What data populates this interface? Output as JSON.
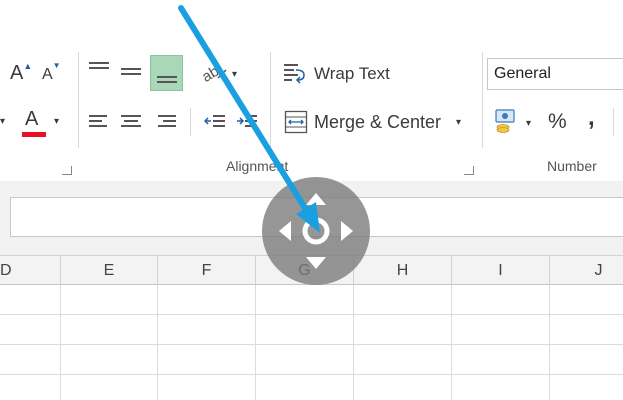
{
  "ribbon": {
    "font_group": {
      "grow_font_label": "A",
      "shrink_font_label": "A",
      "font_color_label": "A",
      "font_color_bar": "#e81123"
    },
    "alignment_group": {
      "label": "Alignment",
      "wrap_text_label": "Wrap Text",
      "merge_center_label": "Merge & Center"
    },
    "number_group": {
      "label": "Number",
      "format_value": "General",
      "percent_label": "%",
      "comma_label": ","
    }
  },
  "grid": {
    "columns": [
      "D",
      "E",
      "F",
      "G",
      "H",
      "I",
      "J"
    ]
  },
  "colors": {
    "active_align_bg": "#a9d8b8",
    "arrow": "#1a9fe0",
    "handle": "#7a7a7a"
  }
}
